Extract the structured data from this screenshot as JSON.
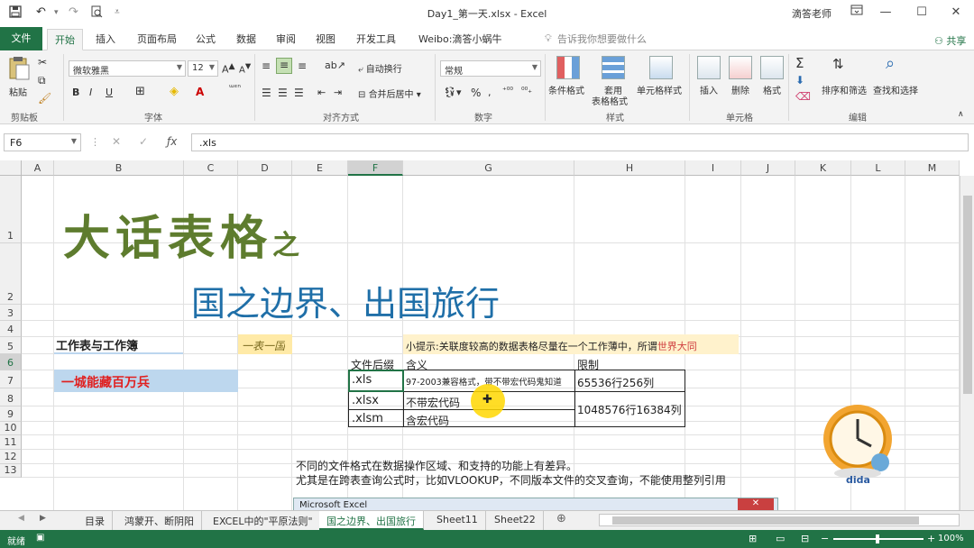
{
  "titlebar": {
    "title": "Day1_第一天.xlsx  -  Excel",
    "user": "滴答老师",
    "qa_save_icon": "save-icon",
    "ribbon_display_icon": "ribbon-display-icon",
    "min": "—",
    "max": "☐",
    "close": "✕"
  },
  "tabs": [
    "文件",
    "开始",
    "插入",
    "页面布局",
    "公式",
    "数据",
    "审阅",
    "视图",
    "开发工具",
    "Weibo:滴答小蜗牛"
  ],
  "tell_me": "告诉我你想要做什么",
  "share": "共享",
  "ribbon": {
    "paste": "粘贴",
    "clipboard": "剪贴板",
    "font_name": "微软雅黑",
    "font_size": "12",
    "font_group": "字体",
    "wrap": "自动换行",
    "merge": "合并后居中",
    "align_group": "对齐方式",
    "number_format": "常规",
    "number_group": "数字",
    "cond_format": "条件格式",
    "table_format_1": "套用",
    "table_format_2": "表格格式",
    "cell_style": "单元格样式",
    "styles_group": "样式",
    "insert": "插入",
    "delete": "删除",
    "format": "格式",
    "cells_group": "单元格",
    "sort_filter": "排序和筛选",
    "find_select": "查找和选择",
    "edit_group": "编辑"
  },
  "formula_bar": {
    "name_box": "F6",
    "formula": ".xls"
  },
  "columns": [
    "A",
    "B",
    "C",
    "D",
    "E",
    "F",
    "G",
    "H",
    "I",
    "J",
    "K",
    "L",
    "M"
  ],
  "rows": [
    "1",
    "2",
    "3",
    "4",
    "5",
    "6",
    "7",
    "8",
    "9",
    "10",
    "11",
    "12",
    "13"
  ],
  "sheet": {
    "title_big": "大话表格",
    "title_small": "之",
    "subtitle": "国之边界、出国旅行",
    "b4": "工作表与工作簿",
    "d4": "一表一国",
    "b6": "一城能藏百万兵",
    "tip_prefix": "小提示:关联度较高的数据表格尽量在一个工作薄中，所谓",
    "tip_highlight": "世界大同",
    "table_header": [
      "文件后缀",
      "含义",
      "限制"
    ],
    "table_rows": [
      {
        "ext": ".xls",
        "meaning": "97-2003兼容格式，带不带宏代码鬼知道",
        "limit": "65536行256列"
      },
      {
        "ext": ".xlsx",
        "meaning": "不带宏代码",
        "limit": "1048576行16384列"
      },
      {
        "ext": ".xlsm",
        "meaning": "含宏代码",
        "limit": ""
      }
    ],
    "note1": "不同的文件格式在数据操作区域、和支持的功能上有差异。",
    "note2": "尤其是在跨表查询公式时，比如VLOOKUP，不同版本文件的交叉查询，不能使用整列引用",
    "dialog_title": "Microsoft Excel",
    "logo_text": "dida"
  },
  "sheet_tabs": [
    "目录",
    "鸿蒙开、断阴阳",
    "EXCEL中的\"平原法则\"",
    "国之边界、出国旅行",
    "Sheet11",
    "Sheet22"
  ],
  "status": {
    "ready": "就绪",
    "zoom": "100%"
  },
  "colors": {
    "excel_green": "#217346",
    "title_green": "#5e7c2e",
    "subtitle_blue": "#1f6fa8",
    "red": "#e02020"
  }
}
